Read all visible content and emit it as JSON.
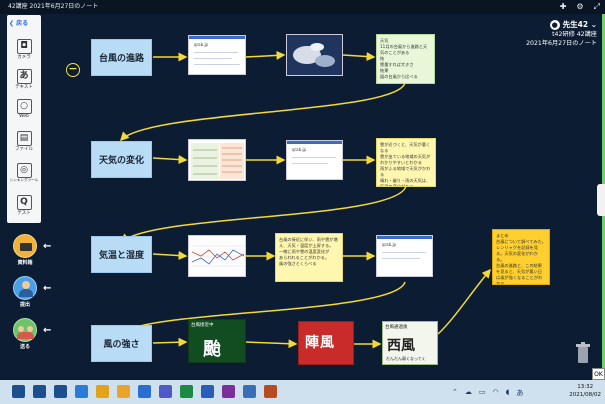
{
  "window": {
    "title": "42講座  2021年6月27日のノート"
  },
  "topbar_icons": [
    "pin-icon",
    "settings-icon",
    "fullscreen-icon"
  ],
  "sidebar": {
    "back_label": "戻る",
    "items": [
      {
        "label": "カメラ",
        "glyph": "◘",
        "icon": "camera-icon"
      },
      {
        "label": "テキスト",
        "glyph": "あ",
        "icon": "text-icon"
      },
      {
        "label": "Web",
        "glyph": "○",
        "icon": "web-icon"
      },
      {
        "label": "ファイル",
        "glyph": "▤",
        "icon": "file-icon"
      },
      {
        "label": "シンキングツール",
        "glyph": "◎",
        "icon": "thinking-tool-icon"
      },
      {
        "label": "テスト",
        "glyph": "Q",
        "icon": "test-icon"
      }
    ]
  },
  "actions": [
    {
      "label": "資料箱",
      "icon": "material-box-icon"
    },
    {
      "label": "提出",
      "icon": "submit-icon"
    },
    {
      "label": "送る",
      "icon": "send-icon"
    }
  ],
  "user": {
    "name": "先生42",
    "class": "t42研修 42講座",
    "note_title": "2021年6月27日のノート"
  },
  "labels": [
    "台風の進路",
    "天気の変化",
    "気温と湿度",
    "風の強さ"
  ],
  "doc_card_title": "qrab.jp",
  "row1": {
    "note": "天気\n11月の台風から進路と天気のことがある\n結\n雲量すれば大きさ\n結果\n図の台風から比べる"
  },
  "row2": {
    "note": "雲が近づくと、天気が悪くなる\n雲が出ている地域の天気がわかりやすいとわかる\n雨がふる地域で天気がかわる\n晴れ・曇り・雨の天気は、気温の変化がある"
  },
  "row3": {
    "note": "台風の接近に伴い、雨や雲が増え、天気・温度が上昇する。\n一緒に雨や雲の温度変化が\nあらわれることがわかる。\n風の強さとくらべる"
  },
  "row4": {
    "green_title": "台風接近中",
    "green_glyph": "颱",
    "red_glyph": "陣風",
    "hand_title": "台風通過後",
    "hand_glyph": "西風",
    "hand_sub": "だんだん弱くなってく"
  },
  "summary": {
    "text": "まとめ\n台風について調べてみた。レンリャクを記録を見る。天気の変化がわかる。\n台風の進路と、この結果を見ると、天気が悪い日は風が強くなることがわかる。"
  },
  "status": {
    "ok_label": "OK"
  },
  "taskbar": {
    "time": "13:32",
    "date": "2021/08/02",
    "ime_label": "あ",
    "apps": [
      {
        "name": "start-button",
        "color": "#1d4f8f"
      },
      {
        "name": "search-icon",
        "color": "#1d4f8f"
      },
      {
        "name": "task-view-icon",
        "color": "#1d4f8f"
      },
      {
        "name": "edge-icon",
        "color": "#2a7ad8"
      },
      {
        "name": "chrome-icon",
        "color": "#e0a31a"
      },
      {
        "name": "explorer-icon",
        "color": "#e9a52b"
      },
      {
        "name": "store-icon",
        "color": "#2b6ed1"
      },
      {
        "name": "teams-icon",
        "color": "#5059c9"
      },
      {
        "name": "excel-icon",
        "color": "#1c8a44"
      },
      {
        "name": "word-icon",
        "color": "#2b5cb8"
      },
      {
        "name": "onenote-icon",
        "color": "#7a2f9a"
      },
      {
        "name": "app-icon",
        "color": "#3a6fb8"
      },
      {
        "name": "note-app-icon",
        "color": "#b84a24"
      }
    ]
  }
}
